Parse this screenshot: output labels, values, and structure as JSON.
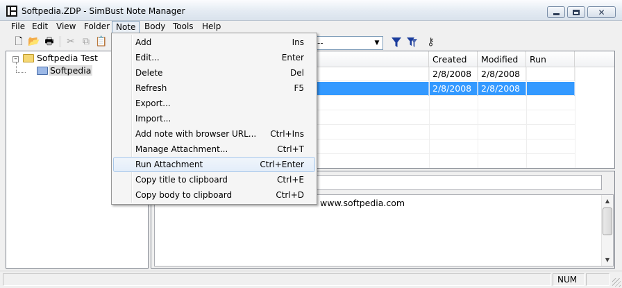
{
  "window": {
    "title": "Softpedia.ZDP - SimBust Note Manager"
  },
  "menubar": {
    "items": [
      "File",
      "Edit",
      "View",
      "Folder",
      "Note",
      "Body",
      "Tools",
      "Help"
    ],
    "active": "Note"
  },
  "toolbar": {
    "combo_value": "--"
  },
  "tree": {
    "root": "Softpedia Test",
    "child": "Softpedia"
  },
  "list": {
    "columns": [
      "Created",
      "Modified",
      "Run"
    ],
    "rows": [
      {
        "created": "2/8/2008",
        "modified": "2/8/2008",
        "run": "",
        "selected": false
      },
      {
        "created": "2/8/2008",
        "modified": "2/8/2008",
        "run": "",
        "selected": true
      }
    ]
  },
  "detail": {
    "title_value": "",
    "body_text": "www.softpedia.com"
  },
  "status": {
    "num": "NUM"
  },
  "note_menu": [
    {
      "label": "Add",
      "shortcut": "Ins"
    },
    {
      "label": "Edit...",
      "shortcut": "Enter"
    },
    {
      "label": "Delete",
      "shortcut": "Del"
    },
    {
      "label": "Refresh",
      "shortcut": "F5"
    },
    {
      "label": "Export...",
      "shortcut": ""
    },
    {
      "label": "Import...",
      "shortcut": ""
    },
    {
      "label": "Add note with browser URL...",
      "shortcut": "Ctrl+Ins"
    },
    {
      "label": "Manage Attachment...",
      "shortcut": "Ctrl+T"
    },
    {
      "label": "Run Attachment",
      "shortcut": "Ctrl+Enter",
      "highlighted": true
    },
    {
      "label": "Copy title to clipboard",
      "shortcut": "Ctrl+E"
    },
    {
      "label": "Copy body to clipboard",
      "shortcut": "Ctrl+D"
    }
  ],
  "colors": {
    "selection": "#3399ff",
    "menu_hover_border": "#a8c8ea",
    "filter_icon": "#1a3c9c"
  }
}
